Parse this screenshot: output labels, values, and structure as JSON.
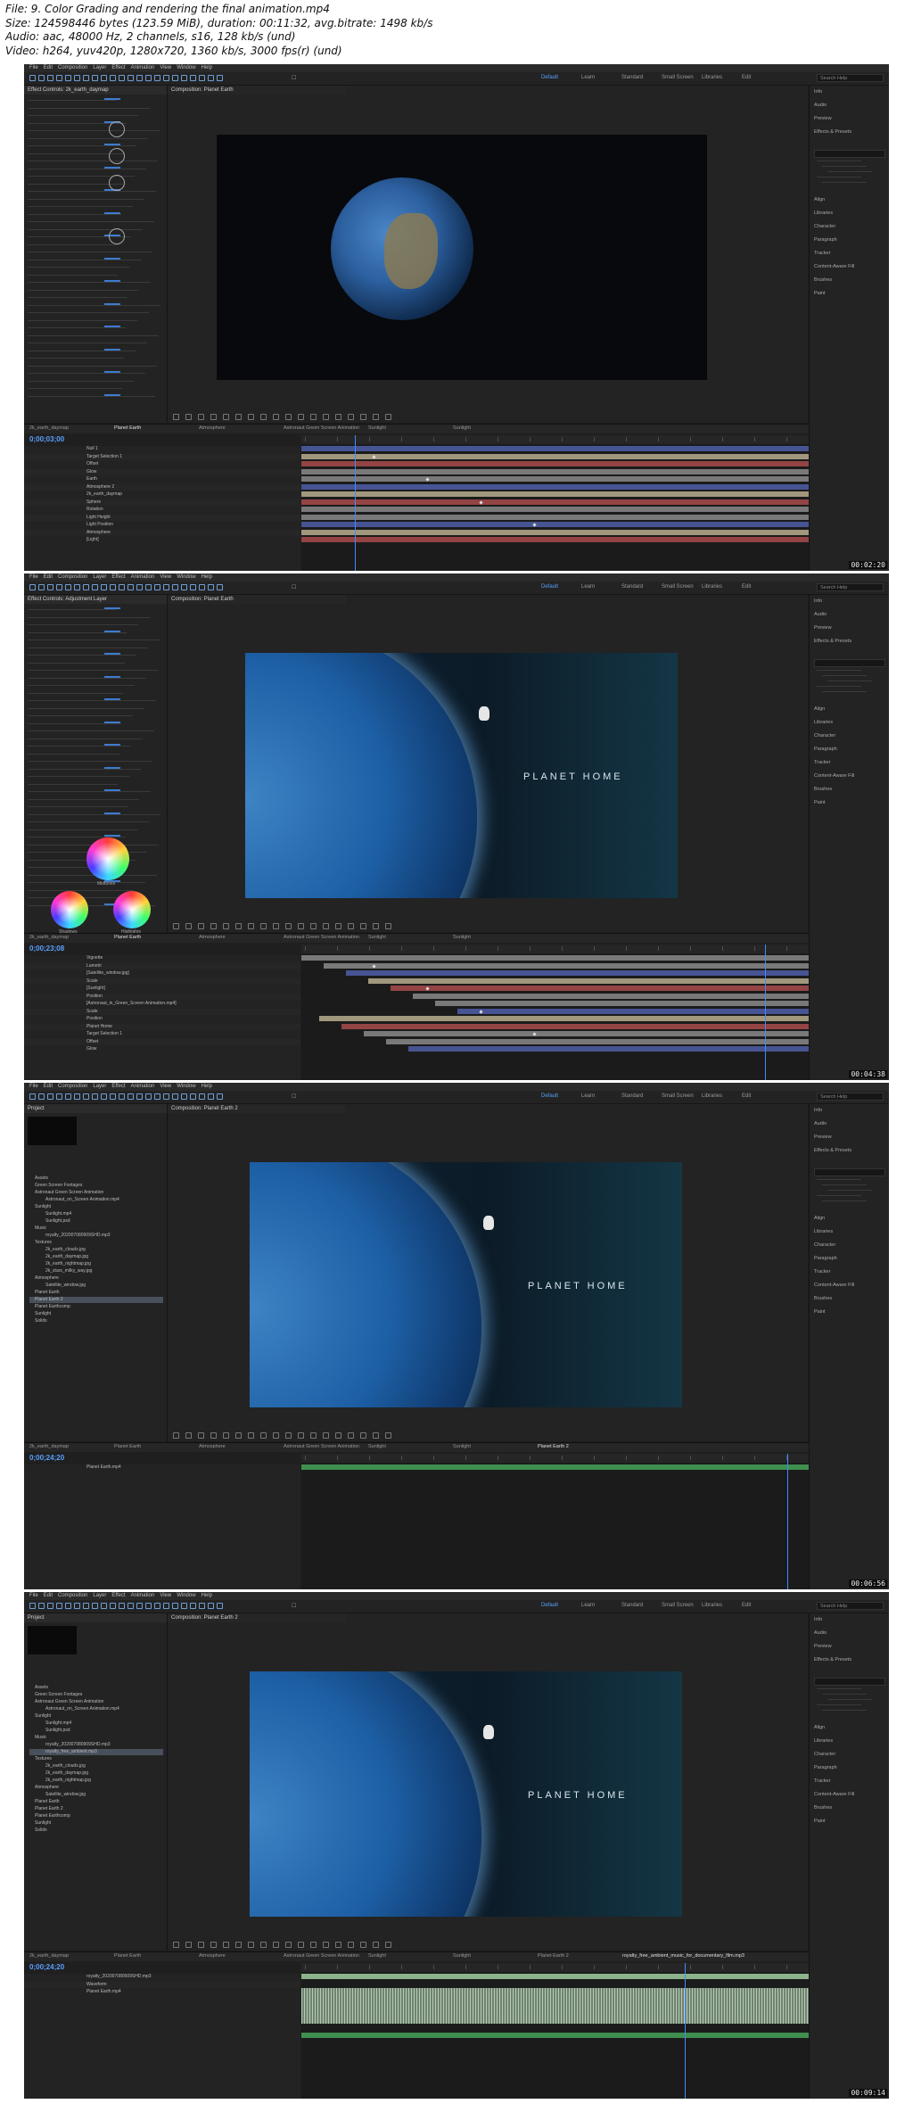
{
  "header": {
    "lines": [
      "File: 9. Color Grading and rendering the final animation.mp4",
      "Size: 124598446 bytes (123.59 MiB), duration: 00:11:32, avg.bitrate: 1498 kb/s",
      "Audio: aac, 48000 Hz, 2 channels, s16, 128 kb/s (und)",
      "Video: h264, yuv420p, 1280x720, 1360 kb/s, 3000 fps(r) (und)"
    ]
  },
  "menu": [
    "File",
    "Edit",
    "Composition",
    "Layer",
    "Effect",
    "Animation",
    "View",
    "Window",
    "Help"
  ],
  "workspaces": [
    "Default",
    "Learn",
    "Standard",
    "Small Screen",
    "Libraries",
    "Edit"
  ],
  "search_help": "Search Help",
  "right_panel_items": [
    "Info",
    "Audio",
    "Preview",
    "Effects & Presets",
    "Align",
    "Libraries",
    "Character",
    "Paragraph",
    "Tracker",
    "Content-Aware Fill",
    "Brushes",
    "Paint"
  ],
  "frames": [
    {
      "timestamp": "00:02:20",
      "timecode": "0;00;03;00",
      "left_panel_title": "Effect Controls: 2k_earth_daymap",
      "comp_tab": "Composition: Planet Earth",
      "tabs": [
        "2k_earth_daymap",
        "Planet Earth",
        "Atmosphere",
        "Astronaut Green Screen Animation",
        "Sunlight",
        "Sunlight"
      ],
      "planet_text": "",
      "layers": [
        "Null 1",
        "Target Selection 1",
        "Offset",
        "Glow",
        "Earth",
        "Atmosphere 2",
        "2k_earth_daymap",
        "Sphere",
        "Rotation",
        "Light Height",
        "Light Position",
        "Atmosphere",
        "[Light]"
      ]
    },
    {
      "timestamp": "00:04:38",
      "timecode": "0;00;23;08",
      "left_panel_title": "Effect Controls: Adjustment Layer",
      "comp_tab": "Composition: Planet Earth",
      "tabs": [
        "2k_earth_daymap",
        "Planet Earth",
        "Atmosphere",
        "Astronaut Green Screen Animation",
        "Sunlight",
        "Sunlight"
      ],
      "planet_text": "PLANET HOME",
      "wheels": [
        "Midtones",
        "Shadows",
        "Highlights"
      ],
      "layers": [
        "Vignette",
        "Lumetri",
        "[Satellite_window.jpg]",
        "Scale",
        "[Sunlight]",
        "Position",
        "[Astronaut_in_Green_Screen Animation.mp4]",
        "Scale",
        "Position",
        "Planet Home",
        "Target Selection 1",
        "Offset",
        "Glow"
      ]
    },
    {
      "timestamp": "00:06:56",
      "timecode": "0;00;24;20",
      "left_panel_title": "Project",
      "comp_tab": "Composition: Planet Earth 2",
      "tabs": [
        "2k_earth_daymap",
        "Planet Earth",
        "Atmosphere",
        "Astronaut Green Screen Animation",
        "Sunlight",
        "Sunlight",
        "Planet Earth 2"
      ],
      "planet_text": "PLANET HOME",
      "project_items": [
        "Assets",
        "Green Screen Footages",
        "Astronaut Green Screen Animation",
        "Astronaut_on_Screen Animation.mp4",
        "Sunlight",
        "Sunlight.mp4",
        "Sunlight.psd",
        "Music",
        "royalty_202007080909SHD.mp3",
        "Textures",
        "2k_earth_clouds.jpg",
        "2k_earth_daymap.jpg",
        "2k_earth_nightmap.jpg",
        "2k_stars_milky_way.jpg",
        "Atmosphere",
        "Satellite_window.jpg",
        "Planet Earth",
        "Planet Earth 2",
        "Planet Earthcomp",
        "Sunlight",
        "Solids"
      ],
      "layers": [
        "Planet Earth.mp4"
      ]
    },
    {
      "timestamp": "00:09:14",
      "timecode": "0;00;24;20",
      "left_panel_title": "Project",
      "comp_tab": "Composition: Planet Earth 2",
      "tabs": [
        "2k_earth_daymap",
        "Planet Earth",
        "Atmosphere",
        "Astronaut Green Screen Animation",
        "Sunlight",
        "Sunlight",
        "Planet Earth 2",
        "royalty_free_ambient_music_for_documentary_film.mp3"
      ],
      "planet_text": "PLANET HOME",
      "project_items": [
        "Assets",
        "Green Screen Footages",
        "Astronaut Green Screen Animation",
        "Astronaut_on_Screen Animation.mp4",
        "Sunlight",
        "Sunlight.mp4",
        "Sunlight.psd",
        "Music",
        "royalty_202007080909SHD.mp3",
        "royalty_free_ambient.mp3",
        "Textures",
        "2k_earth_clouds.jpg",
        "2k_earth_daymap.jpg",
        "2k_earth_nightmap.jpg",
        "Atmosphere",
        "Satellite_window.jpg",
        "Planet Earth",
        "Planet Earth 2",
        "Planet Earthcomp",
        "Sunlight",
        "Solids"
      ],
      "layers": [
        "royalty_202007080909SHD.mp3",
        "Waveform",
        "Planet Earth.mp4"
      ]
    }
  ]
}
